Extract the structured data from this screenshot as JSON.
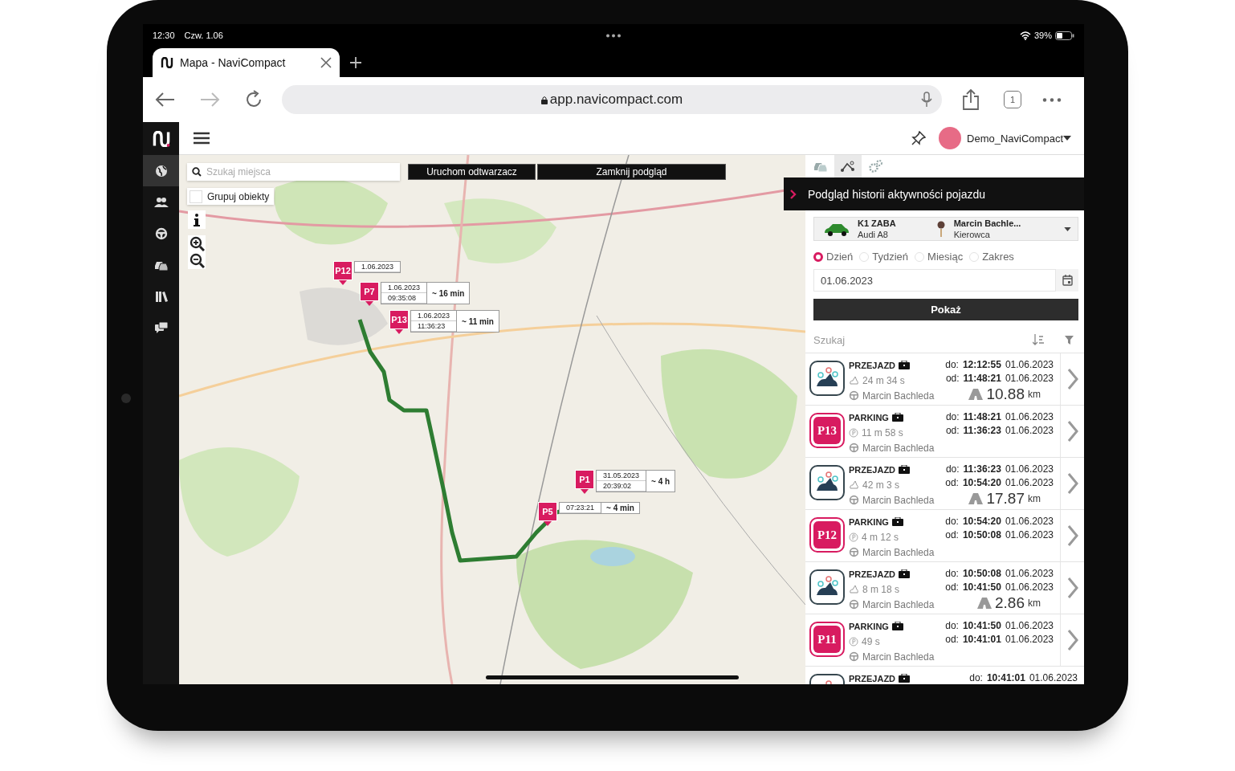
{
  "status_bar": {
    "time": "12:30",
    "date": "Czw. 1.06",
    "battery": "39%"
  },
  "browser": {
    "tab_title": "Mapa - NaviCompact",
    "url": "app.navicompact.com",
    "tab_count": "1"
  },
  "header": {
    "user": "Demo_NaviCompact"
  },
  "sidebar": {
    "items": [
      {
        "selected": true
      },
      {
        "selected": false
      },
      {
        "selected": false
      },
      {
        "selected": false
      },
      {
        "selected": false
      },
      {
        "selected": false
      }
    ]
  },
  "map": {
    "search": {
      "placeholder": "Szukaj miejsca"
    },
    "buttons": [
      "Uruchom odtwarzacz",
      "Zamknij podgląd"
    ],
    "group_checkbox": {
      "label": "Grupuj obiekty",
      "checked": false
    },
    "markers": [
      {
        "label": "P12",
        "date": "1.06.2023"
      },
      {
        "label": "P7",
        "date": "1.06.2023",
        "time": "09:35:08",
        "duration": "~ 16 min"
      },
      {
        "label": "P13",
        "date": "1.06.2023",
        "time": "11:36:23",
        "duration": "~ 11 min"
      },
      {
        "label": "P1",
        "date": "31.05.2023",
        "time": "20:39:02",
        "duration": "~ 4 h"
      },
      {
        "label": "P5",
        "time": "07:23:21",
        "duration": "~ 4 min"
      }
    ]
  },
  "panel": {
    "tabs": [
      {
        "selected": false
      },
      {
        "selected": true
      },
      {
        "selected": false
      }
    ],
    "title": "Podgląd historii aktywności pojazdu",
    "vehicle": {
      "plate": "K1 ZABA",
      "model": "Audi A8",
      "driver": "Marcin Bachle...",
      "role": "Kierowca"
    },
    "periods": [
      {
        "label": "Dzień",
        "selected": true
      },
      {
        "label": "Tydzień",
        "selected": false
      },
      {
        "label": "Miesiąc",
        "selected": false
      },
      {
        "label": "Zakres",
        "selected": false
      }
    ],
    "date": "01.06.2023",
    "show_button": "Pokaż",
    "search": {
      "placeholder": "Szukaj"
    },
    "events": [
      {
        "kind": "trip",
        "title": "PRZEJAZD",
        "duration": "24 m 34 s",
        "driver": "Marcin Bachleda",
        "to_label": "do:",
        "to_time": "12:12:55",
        "to_date": "01.06.2023",
        "from_label": "od:",
        "from_time": "11:48:21",
        "from_date": "01.06.2023",
        "distance": "10.88",
        "unit": "km"
      },
      {
        "kind": "parking",
        "badge": "P13",
        "title": "PARKING",
        "duration": "11 m 58 s",
        "driver": "Marcin Bachleda",
        "to_label": "do:",
        "to_time": "11:48:21",
        "to_date": "01.06.2023",
        "from_label": "od:",
        "from_time": "11:36:23",
        "from_date": "01.06.2023"
      },
      {
        "kind": "trip",
        "title": "PRZEJAZD",
        "duration": "42 m 3 s",
        "driver": "Marcin Bachleda",
        "to_label": "do:",
        "to_time": "11:36:23",
        "to_date": "01.06.2023",
        "from_label": "od:",
        "from_time": "10:54:20",
        "from_date": "01.06.2023",
        "distance": "17.87",
        "unit": "km"
      },
      {
        "kind": "parking",
        "badge": "P12",
        "title": "PARKING",
        "duration": "4 m 12 s",
        "driver": "Marcin Bachleda",
        "to_label": "do:",
        "to_time": "10:54:20",
        "to_date": "01.06.2023",
        "from_label": "od:",
        "from_time": "10:50:08",
        "from_date": "01.06.2023"
      },
      {
        "kind": "trip",
        "title": "PRZEJAZD",
        "duration": "8 m 18 s",
        "driver": "Marcin Bachleda",
        "to_label": "do:",
        "to_time": "10:50:08",
        "to_date": "01.06.2023",
        "from_label": "od:",
        "from_time": "10:41:50",
        "from_date": "01.06.2023",
        "distance": "2.86",
        "unit": "km"
      },
      {
        "kind": "parking",
        "badge": "P11",
        "title": "PARKING",
        "duration": "49 s",
        "driver": "Marcin Bachleda",
        "to_label": "do:",
        "to_time": "10:41:50",
        "to_date": "01.06.2023",
        "from_label": "od:",
        "from_time": "10:41:01",
        "from_date": "01.06.2023"
      },
      {
        "kind": "trip",
        "title": "PRZEJAZD",
        "to_label": "do:",
        "to_time": "10:41:01",
        "to_date": "01.06.2023"
      }
    ]
  }
}
